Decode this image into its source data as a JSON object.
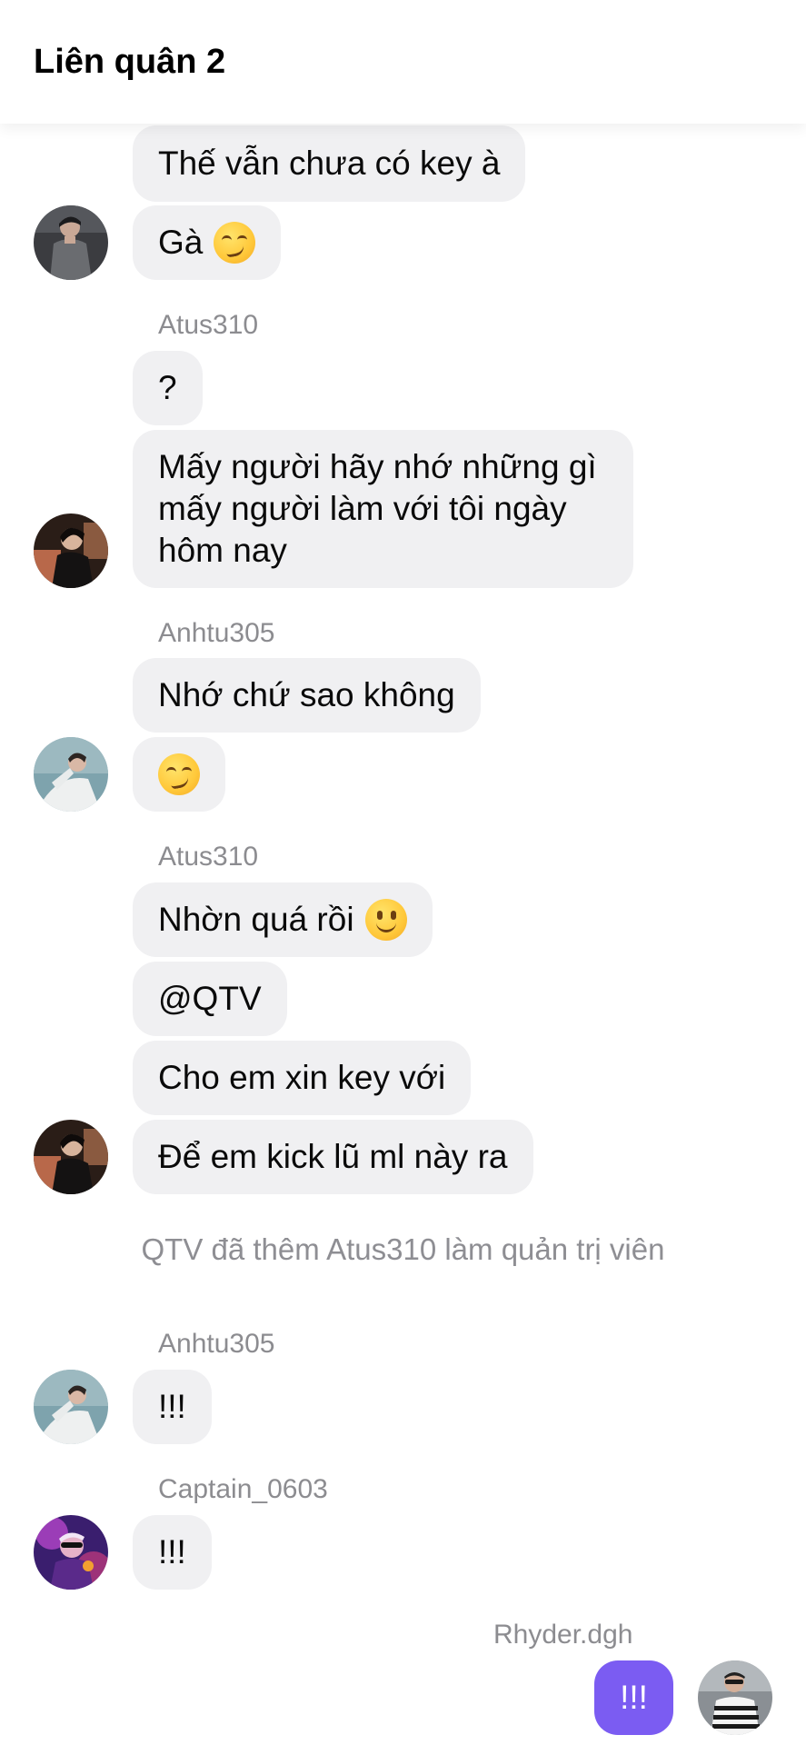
{
  "header": {
    "title": "Liên quân 2"
  },
  "messages": {
    "m1": "Thế vẫn chưa có key à",
    "m2": "Gà",
    "atus_name_1": "Atus310",
    "m3": "?",
    "m4_line1": "Mấy người hãy nhớ những gì",
    "m4_line2": "mấy người làm với tôi ngày",
    "m4_line3": "hôm nay",
    "anhtu_name_1": "Anhtu305",
    "m5": "Nhớ chứ sao không",
    "atus_name_2": "Atus310",
    "m7": "Nhờn quá rồi",
    "m8": "@QTV",
    "m9": "Cho em xin key với",
    "m10": "Để em kick lũ ml này ra",
    "system_notice": "QTV đã thêm Atus310 làm quản trị viên",
    "anhtu_name_2": "Anhtu305",
    "m11": "!!!",
    "captain_name": "Captain_0603",
    "m12": "!!!",
    "rhyder_name": "Rhyder.dgh",
    "m13": "!!!"
  },
  "emojis": {
    "m2": "smirking-face",
    "m6": "smirking-face",
    "m7": "slightly-smiling-face"
  },
  "colors": {
    "incoming_bubble": "#f0f0f2",
    "outgoing_bubble": "#7b5cf2",
    "sender_name": "#8c8c90"
  }
}
